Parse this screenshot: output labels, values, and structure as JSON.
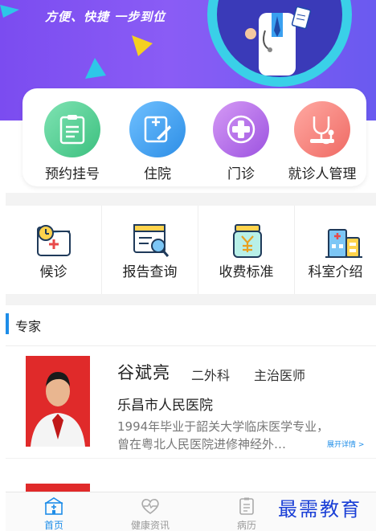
{
  "banner": {
    "slogan": "方便、快捷 一步到位"
  },
  "quick_nav": [
    {
      "label": "预约挂号",
      "icon": "clipboard-icon",
      "color": "#5dd39a"
    },
    {
      "label": "住院",
      "icon": "edit-form-icon",
      "color": "#3aa0f0"
    },
    {
      "label": "门诊",
      "icon": "medical-cross-icon",
      "color": "#b46ae8"
    },
    {
      "label": "就诊人管理",
      "icon": "stethoscope-icon",
      "color": "#f07a74"
    }
  ],
  "services": [
    {
      "label": "候诊",
      "icon": "folder-plus-icon"
    },
    {
      "label": "报告查询",
      "icon": "report-search-icon"
    },
    {
      "label": "收费标准",
      "icon": "yen-jar-icon"
    },
    {
      "label": "科室介绍",
      "icon": "building-icon"
    }
  ],
  "section": {
    "title": "专家"
  },
  "doctor": {
    "name": "谷斌亮",
    "department": "二外科",
    "title": "主治医师",
    "hospital": "乐昌市人民医院",
    "desc_line1": "1994年毕业于韶关大学临床医学专业，",
    "desc_line2": "曾在粤北人民医院进修神经外…",
    "more": "展开详情 >"
  },
  "tabbar": {
    "tabs": [
      {
        "label": "首页",
        "icon": "hospital-icon",
        "active": true
      },
      {
        "label": "健康资讯",
        "icon": "heartbeat-icon",
        "active": false
      },
      {
        "label": "病历",
        "icon": "medical-record-icon",
        "active": false
      }
    ]
  },
  "watermark": "最需教育",
  "colors": {
    "accent": "#1e8de8",
    "banner": "#7b4cf0"
  }
}
